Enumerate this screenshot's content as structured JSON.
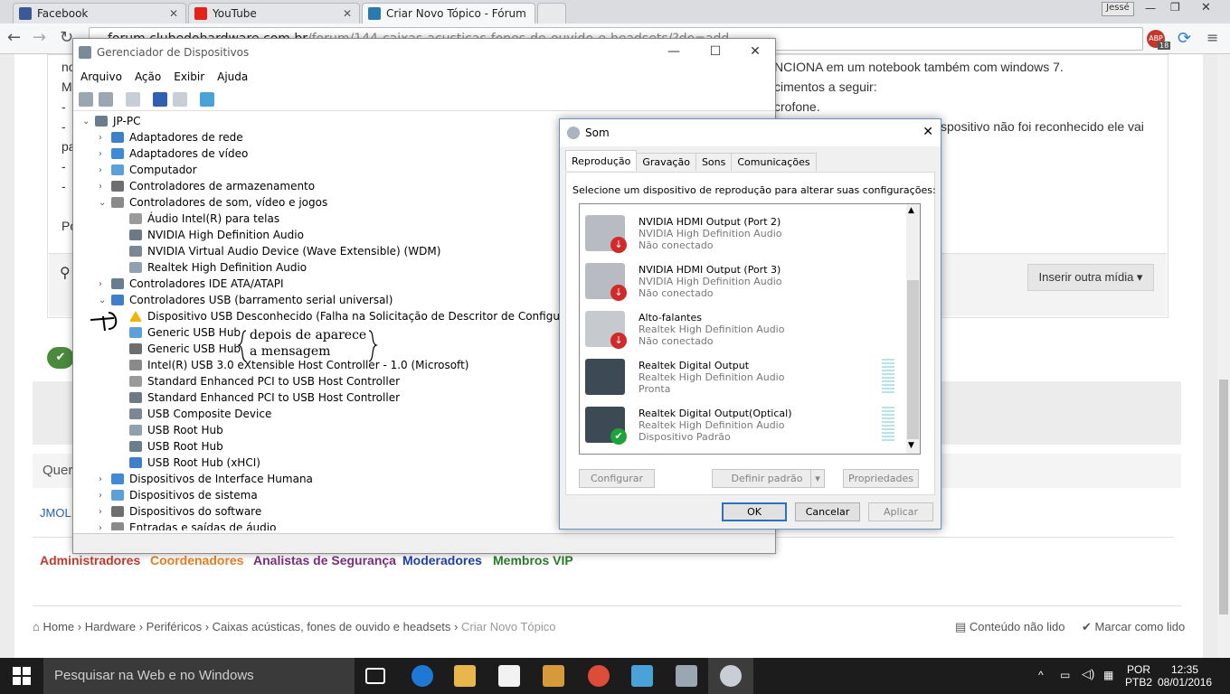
{
  "browser": {
    "tabs": [
      {
        "label": "Facebook",
        "color": "#3b5998"
      },
      {
        "label": "YouTube",
        "color": "#e62117"
      },
      {
        "label": "Criar Novo Tópico - Fórum",
        "color": "#2a7ab0"
      }
    ],
    "user": "Jessé",
    "url_host": "forum.clubedohardware.com.br",
    "url_path": "/forum/144-caixas-acusticas-fones-de-ouvido-e-headsets/?do=add",
    "ext_badge": "18"
  },
  "page": {
    "lines": [
      {
        "text": "NCIONA em um notebook também com windows 7."
      },
      {
        "text": "cimentos a seguir:"
      },
      {
        "text": "crofone."
      },
      {
        "text": "spositivo não foi reconhecido ele vai"
      }
    ],
    "left_fragments": [
      "no",
      "M",
      "-",
      "-",
      "pa",
      "-",
      "-",
      "Po"
    ],
    "insert_media": "Inserir outra mídia ▾",
    "que": "Quer",
    "jmol": "JMOL",
    "groups": [
      {
        "label": "Administradores",
        "color": "#c0392b"
      },
      {
        "label": "Coordenadores",
        "color": "#e67e22"
      },
      {
        "label": "Analistas de Segurança",
        "color": "#7b2d7b"
      },
      {
        "label": "Moderadores",
        "color": "#1f3fa6"
      },
      {
        "label": "Membros VIP",
        "color": "#2a7a2a"
      }
    ],
    "breadcrumb": [
      "Home",
      "Hardware",
      "Periféricos",
      "Caixas acústicas, fones de ouvido e headsets",
      "Criar Novo Tópico"
    ],
    "unread": "Conteúdo não lido",
    "mark_read": "Marcar como lido"
  },
  "devmgr": {
    "title": "Gerenciador de Dispositivos",
    "menu": [
      "Arquivo",
      "Ação",
      "Exibir",
      "Ajuda"
    ],
    "tree": [
      {
        "label": "JP-PC",
        "level": 0,
        "arrow": "v"
      },
      {
        "label": "Adaptadores de rede",
        "level": 1,
        "arrow": ">"
      },
      {
        "label": "Adaptadores de vídeo",
        "level": 1,
        "arrow": ">"
      },
      {
        "label": "Computador",
        "level": 1,
        "arrow": ">"
      },
      {
        "label": "Controladores de armazenamento",
        "level": 1,
        "arrow": ">"
      },
      {
        "label": "Controladores de som, vídeo e jogos",
        "level": 1,
        "arrow": "v"
      },
      {
        "label": "Áudio Intel(R) para telas",
        "level": 2,
        "arrow": ""
      },
      {
        "label": "NVIDIA High Definition Audio",
        "level": 2,
        "arrow": ""
      },
      {
        "label": "NVIDIA Virtual Audio Device (Wave Extensible) (WDM)",
        "level": 2,
        "arrow": ""
      },
      {
        "label": "Realtek High Definition Audio",
        "level": 2,
        "arrow": ""
      },
      {
        "label": "Controladores IDE ATA/ATAPI",
        "level": 1,
        "arrow": ">"
      },
      {
        "label": "Controladores USB (barramento serial universal)",
        "level": 1,
        "arrow": "v"
      },
      {
        "label": "Dispositivo USB Desconhecido (Falha na Solicitação de Descritor de Configuração)",
        "level": 2,
        "arrow": "",
        "warn": true
      },
      {
        "label": "Generic USB Hub",
        "level": 2,
        "arrow": ""
      },
      {
        "label": "Generic USB Hub",
        "level": 2,
        "arrow": ""
      },
      {
        "label": "Intel(R) USB 3.0 eXtensible Host Controller - 1.0 (Microsoft)",
        "level": 2,
        "arrow": ""
      },
      {
        "label": "Standard Enhanced PCI to USB Host Controller",
        "level": 2,
        "arrow": ""
      },
      {
        "label": "Standard Enhanced PCI to USB Host Controller",
        "level": 2,
        "arrow": ""
      },
      {
        "label": "USB Composite Device",
        "level": 2,
        "arrow": ""
      },
      {
        "label": "USB Root Hub",
        "level": 2,
        "arrow": ""
      },
      {
        "label": "USB Root Hub",
        "level": 2,
        "arrow": ""
      },
      {
        "label": "USB Root Hub (xHCI)",
        "level": 2,
        "arrow": ""
      },
      {
        "label": "Dispositivos de Interface Humana",
        "level": 1,
        "arrow": ">"
      },
      {
        "label": "Dispositivos de sistema",
        "level": 1,
        "arrow": ">"
      },
      {
        "label": "Dispositivos do software",
        "level": 1,
        "arrow": ">"
      },
      {
        "label": "Entradas e saídas de áudio",
        "level": 1,
        "arrow": ">"
      }
    ],
    "annotation": "depois de aparece a mensagem"
  },
  "som": {
    "title": "Som",
    "tabs": [
      "Reprodução",
      "Gravação",
      "Sons",
      "Comunicações"
    ],
    "instruction": "Selecione um dispositivo de reprodução para alterar suas configurações:",
    "devices": [
      {
        "name": "NVIDIA HDMI Output (Port 2)",
        "driver": "NVIDIA High Definition Audio",
        "status": "Não conectado",
        "badge": "down"
      },
      {
        "name": "NVIDIA HDMI Output (Port 3)",
        "driver": "NVIDIA High Definition Audio",
        "status": "Não conectado",
        "badge": "down"
      },
      {
        "name": "Alto-falantes",
        "driver": "Realtek High Definition Audio",
        "status": "Não conectado",
        "badge": "down"
      },
      {
        "name": "Realtek Digital Output",
        "driver": "Realtek High Definition Audio",
        "status": "Pronta",
        "badge": ""
      },
      {
        "name": "Realtek Digital Output(Optical)",
        "driver": "Realtek High Definition Audio",
        "status": "Dispositivo Padrão",
        "badge": "check"
      }
    ],
    "configure": "Configurar",
    "set_default": "Definir padrão",
    "properties": "Propriedades",
    "ok": "OK",
    "cancel": "Cancelar",
    "apply": "Aplicar"
  },
  "taskbar": {
    "search_placeholder": "Pesquisar na Web e no Windows",
    "lang1": "POR",
    "lang2": "PTB2",
    "time": "12:35",
    "date": "08/01/2016"
  }
}
